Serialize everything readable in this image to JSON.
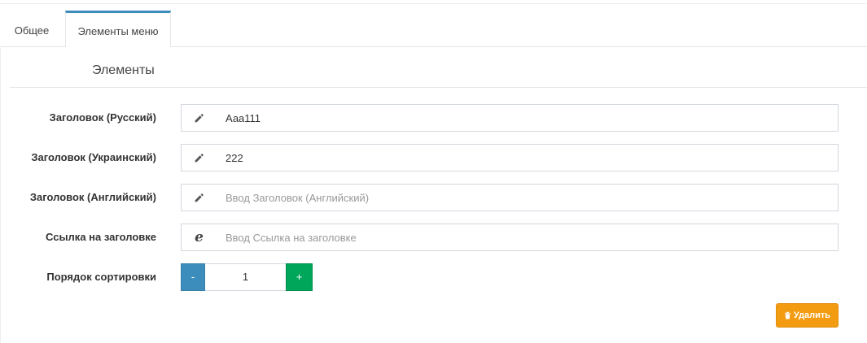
{
  "tabs": [
    {
      "label": "Общее",
      "active": false
    },
    {
      "label": "Элементы меню",
      "active": true
    }
  ],
  "section": {
    "title": "Элементы"
  },
  "fields": [
    {
      "label": "Заголовок (Русский)",
      "icon": "pencil-icon",
      "value": "Ааа111",
      "placeholder": ""
    },
    {
      "label": "Заголовок (Украинский)",
      "icon": "pencil-icon",
      "value": "222",
      "placeholder": ""
    },
    {
      "label": "Заголовок (Английский)",
      "icon": "pencil-icon",
      "value": "",
      "placeholder": "Ввод Заголовок (Английский)"
    },
    {
      "label": "Ссылка на заголовке",
      "icon": "internet-explorer-icon",
      "value": "",
      "placeholder": "Ввод Ссылка на заголовке"
    }
  ],
  "sort": {
    "label": "Порядок сортировки",
    "minus": "-",
    "value": "1",
    "plus": "+"
  },
  "delete_button": {
    "label": "Удалить",
    "icon": "trash-icon"
  },
  "colors": {
    "primary": "#3c8dbc",
    "success": "#00a65a",
    "warning": "#f39c12"
  }
}
